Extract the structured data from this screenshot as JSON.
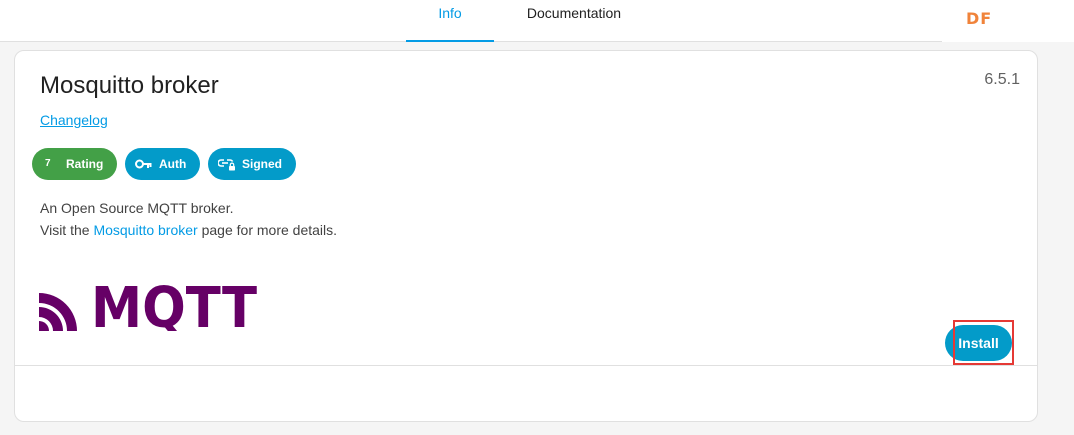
{
  "tabs": {
    "info": "Info",
    "documentation": "Documentation"
  },
  "brand_mark": "DF",
  "addon": {
    "title": "Mosquitto broker",
    "version": "6.5.1",
    "changelog_label": "Changelog",
    "badges": {
      "rating_value": "7",
      "rating_label": "Rating",
      "auth_label": "Auth",
      "signed_label": "Signed"
    },
    "description_line1": "An Open Source MQTT broker.",
    "description_line2_prefix": "Visit the ",
    "description_link": "Mosquitto broker",
    "description_line2_suffix": " page for more details.",
    "logo_text": "MQTT"
  },
  "actions": {
    "install_label": "Install"
  },
  "colors": {
    "accent": "#039be5",
    "rating_green": "#43a047",
    "mqtt_purple": "#660066",
    "highlight_red": "#e53935"
  },
  "icons": {
    "auth": "key-icon",
    "signed": "link-lock-icon"
  }
}
